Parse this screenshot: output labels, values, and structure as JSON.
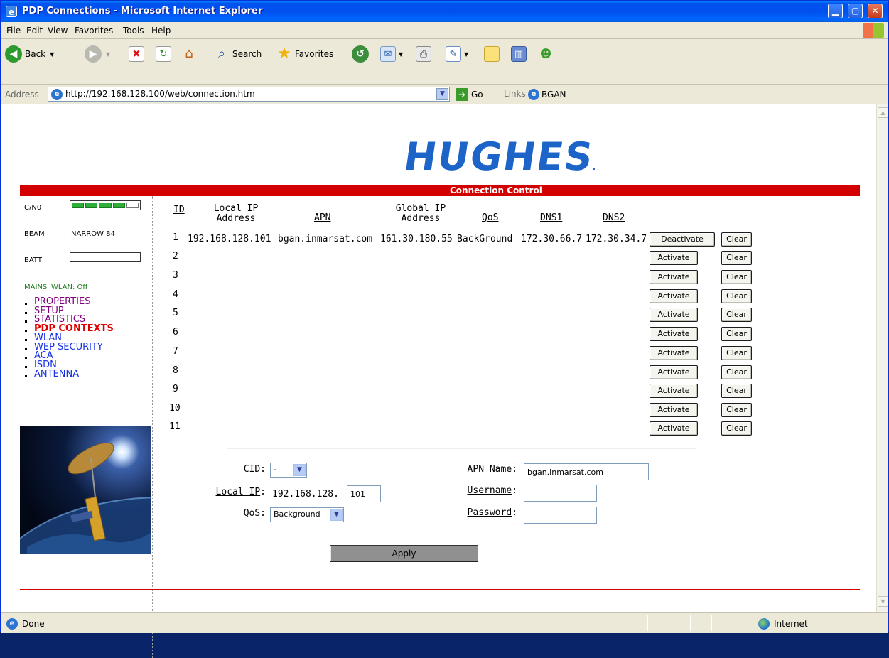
{
  "window": {
    "title": "PDP Connections - Microsoft Internet Explorer",
    "icon": "ie-icon"
  },
  "menu": [
    "File",
    "Edit",
    "View",
    "Favorites",
    "Tools",
    "Help"
  ],
  "toolbar": {
    "back": "Back",
    "search": "Search",
    "favorites": "Favorites"
  },
  "address": {
    "label": "Address",
    "url": "http://192.168.128.100/web/connection.htm",
    "go": "Go",
    "links_label": "Links",
    "link_bgan": "BGAN"
  },
  "page": {
    "logo": "HUGHES",
    "section_title": "Connection Control",
    "status": {
      "cn0_label": "C/N0",
      "cn0_segments_filled": 4,
      "cn0_segments_total": 5,
      "beam_label": "BEAM",
      "beam_value": "NARROW 84",
      "batt_label": "BATT",
      "mains_label": "MAINS",
      "wlan_status": "WLAN: Off"
    },
    "nav": [
      {
        "label": "PROPERTIES",
        "state": "visited"
      },
      {
        "label": "SETUP",
        "state": "visited"
      },
      {
        "label": "STATISTICS",
        "state": "visited"
      },
      {
        "label": "PDP CONTEXTS",
        "state": "current"
      },
      {
        "label": "WLAN",
        "state": "link"
      },
      {
        "label": "WEP SECURITY",
        "state": "link"
      },
      {
        "label": "ACA",
        "state": "link"
      },
      {
        "label": "ISDN",
        "state": "link"
      },
      {
        "label": "ANTENNA",
        "state": "link"
      }
    ],
    "table": {
      "headers": {
        "id": "ID",
        "local_ip_1": "Local IP",
        "local_ip_2": "Address",
        "apn": "APN",
        "global_ip_1": "Global IP",
        "global_ip_2": "Address",
        "qos": "QoS",
        "dns1": "DNS1",
        "dns2": "DNS2"
      },
      "rows": [
        {
          "id": "1",
          "local_ip": "192.168.128.101",
          "apn": "bgan.inmarsat.com",
          "global_ip": "161.30.180.55",
          "qos": "BackGround",
          "dns1": "172.30.66.7",
          "dns2": "172.30.34.7",
          "action": "Deactivate",
          "clear": "Clear"
        },
        {
          "id": "2",
          "action": "Activate",
          "clear": "Clear"
        },
        {
          "id": "3",
          "action": "Activate",
          "clear": "Clear"
        },
        {
          "id": "4",
          "action": "Activate",
          "clear": "Clear"
        },
        {
          "id": "5",
          "action": "Activate",
          "clear": "Clear"
        },
        {
          "id": "6",
          "action": "Activate",
          "clear": "Clear"
        },
        {
          "id": "7",
          "action": "Activate",
          "clear": "Clear"
        },
        {
          "id": "8",
          "action": "Activate",
          "clear": "Clear"
        },
        {
          "id": "9",
          "action": "Activate",
          "clear": "Clear"
        },
        {
          "id": "10",
          "action": "Activate",
          "clear": "Clear"
        },
        {
          "id": "11",
          "action": "Activate",
          "clear": "Clear"
        }
      ]
    },
    "form": {
      "cid_label": "CID",
      "cid_value": "-",
      "local_ip_label": "Local IP",
      "local_ip_prefix": "192.168.128.",
      "local_ip_suffix": "101",
      "qos_label": "QoS",
      "qos_value": "Background",
      "apn_name_label": "APN Name",
      "apn_name_value": "bgan.inmarsat.com",
      "username_label": "Username",
      "username_value": "",
      "password_label": "Password",
      "password_value": "",
      "apply": "Apply"
    }
  },
  "statusbar": {
    "text": "Done",
    "zone": "Internet"
  },
  "colors": {
    "accent_red": "#d30000",
    "logo_blue": "#1d64c9",
    "visited": "#800080",
    "link": "#1530e8",
    "current": "#e00000"
  }
}
